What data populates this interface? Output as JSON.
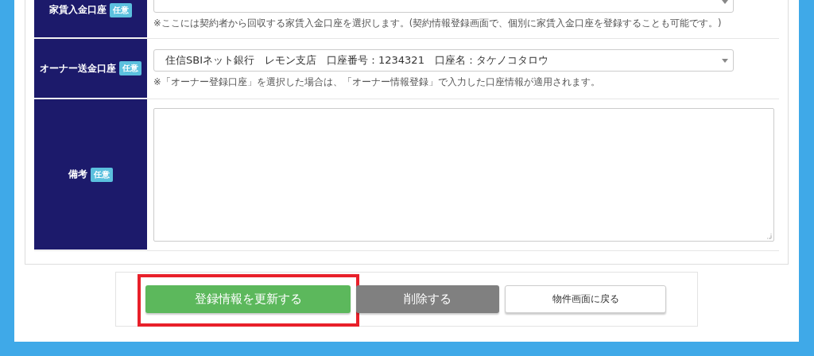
{
  "form_rows": [
    {
      "kind": "select",
      "label": "家賃入金口座",
      "badge": "任意",
      "note": "※ここには契約者から回収する家賃入金口座を選択します。(契約情報登録画面で、個別に家賃入金口座を登録することも可能です。)"
    },
    {
      "kind": "select",
      "label": "オーナー送金口座",
      "badge": "任意",
      "value": "住信SBIネット銀行　レモン支店　口座番号：1234321　口座名：タケノコタロウ",
      "note": "※「オーナー登録口座」を選択した場合は、「オーナー情報登録」で入力した口座情報が適用されます。"
    },
    {
      "kind": "textarea",
      "label": "備考",
      "badge": "任意"
    }
  ],
  "buttons": [
    {
      "kind": "primary",
      "label": "登録情報を更新する",
      "highlighted": true
    },
    {
      "kind": "danger",
      "label": "削除する",
      "highlighted": false
    },
    {
      "kind": "default",
      "label": "物件画面に戻る",
      "highlighted": false
    }
  ]
}
